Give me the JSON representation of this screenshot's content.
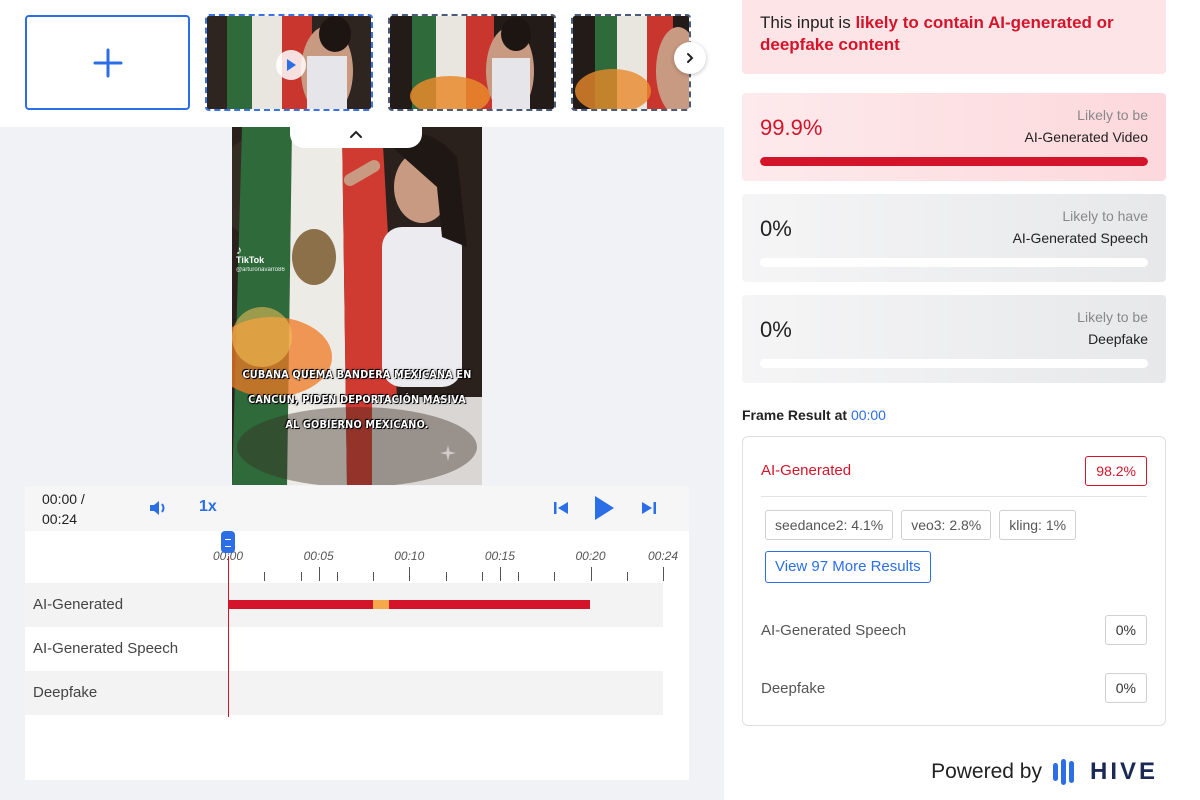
{
  "thumbnails": [
    {
      "name": "frame-1",
      "selected": true
    },
    {
      "name": "frame-2",
      "selected": false
    },
    {
      "name": "frame-3",
      "selected": false
    }
  ],
  "video": {
    "caption_lines": [
      "CUBANA QUEMA BANDERA MEXICANA EN",
      "CANCUN, PIDEN DEPORTACIÓN MASIVA",
      "AL GOBIERNO MEXICANO."
    ],
    "watermark": "TikTok",
    "watermark_handle": "@arturonavarro86"
  },
  "player": {
    "time_current": "00:00 /",
    "time_total": "00:24",
    "speed": "1x",
    "ticks": [
      "00:00",
      "00:05",
      "00:10",
      "00:15",
      "00:20",
      "00:24"
    ],
    "tracks": [
      {
        "label": "AI-Generated"
      },
      {
        "label": "AI-Generated Speech"
      },
      {
        "label": "Deepfake"
      }
    ]
  },
  "banner": {
    "prefix": "This input is ",
    "highlight": "likely to contain AI-generated or deepfake content"
  },
  "cards": [
    {
      "pct": "99.9%",
      "line1": "Likely to be",
      "line2": "AI-Generated Video",
      "fill": 1.0,
      "tone": "red"
    },
    {
      "pct": "0%",
      "line1": "Likely to have",
      "line2": "AI-Generated Speech",
      "fill": 0.0,
      "tone": "gray"
    },
    {
      "pct": "0%",
      "line1": "Likely to be",
      "line2": "Deepfake",
      "fill": 0.0,
      "tone": "gray"
    }
  ],
  "frame_result": {
    "title": "Frame Result at",
    "time": "00:00",
    "ai_label": "AI-Generated",
    "ai_value": "98.2%",
    "chips": [
      "seedance2: 4.1%",
      "veo3: 2.8%",
      "kling: 1%"
    ],
    "more_button": "View 97 More Results",
    "speech_label": "AI-Generated Speech",
    "speech_value": "0%",
    "deepfake_label": "Deepfake",
    "deepfake_value": "0%"
  },
  "footer": {
    "powered_by": "Powered by",
    "brand": "HIVE"
  },
  "colors": {
    "accent": "#2b6ee6",
    "alert": "#d4142a",
    "warning": "#f5a94a"
  }
}
